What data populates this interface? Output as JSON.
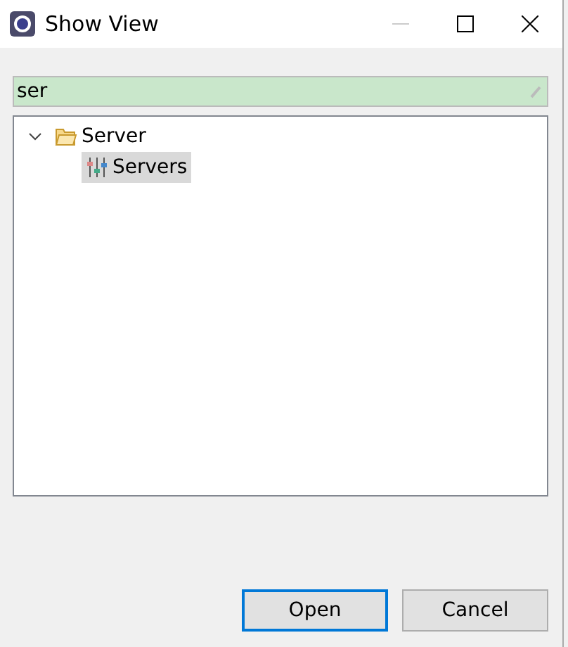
{
  "window": {
    "title": "Show View"
  },
  "search": {
    "value": "ser"
  },
  "tree": [
    {
      "label": "Server",
      "kind": "folder",
      "expanded": true,
      "selected": false,
      "children": [
        {
          "label": "Servers",
          "kind": "view",
          "selected": true
        }
      ]
    }
  ],
  "buttons": [
    {
      "label": "Open",
      "default": true
    },
    {
      "label": "Cancel",
      "default": false
    }
  ]
}
